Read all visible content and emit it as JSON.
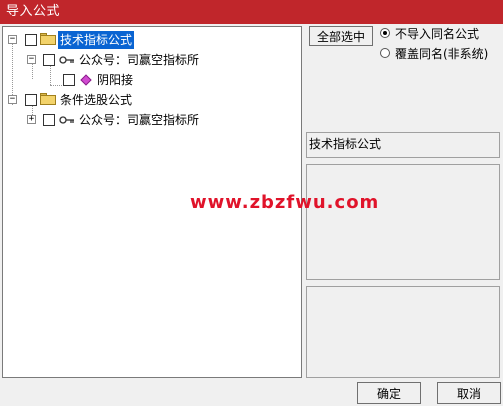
{
  "window": {
    "title": "导入公式"
  },
  "tree": {
    "nodes": [
      {
        "label": "技术指标公式",
        "selected": true
      },
      {
        "label": "公众号：司赢空指标所"
      },
      {
        "label": "阴阳接"
      },
      {
        "label": "条件选股公式"
      },
      {
        "label": "公众号：司赢空指标所"
      }
    ]
  },
  "right": {
    "select_all_label": "全部选中",
    "options": [
      {
        "label": "不导入同名公式",
        "selected": true
      },
      {
        "label": "覆盖同名(非系统)",
        "selected": false
      }
    ],
    "info_text": "技术指标公式"
  },
  "watermark": "www.zbzfwu.com",
  "buttons": {
    "ok": "确定",
    "cancel": "取消"
  }
}
